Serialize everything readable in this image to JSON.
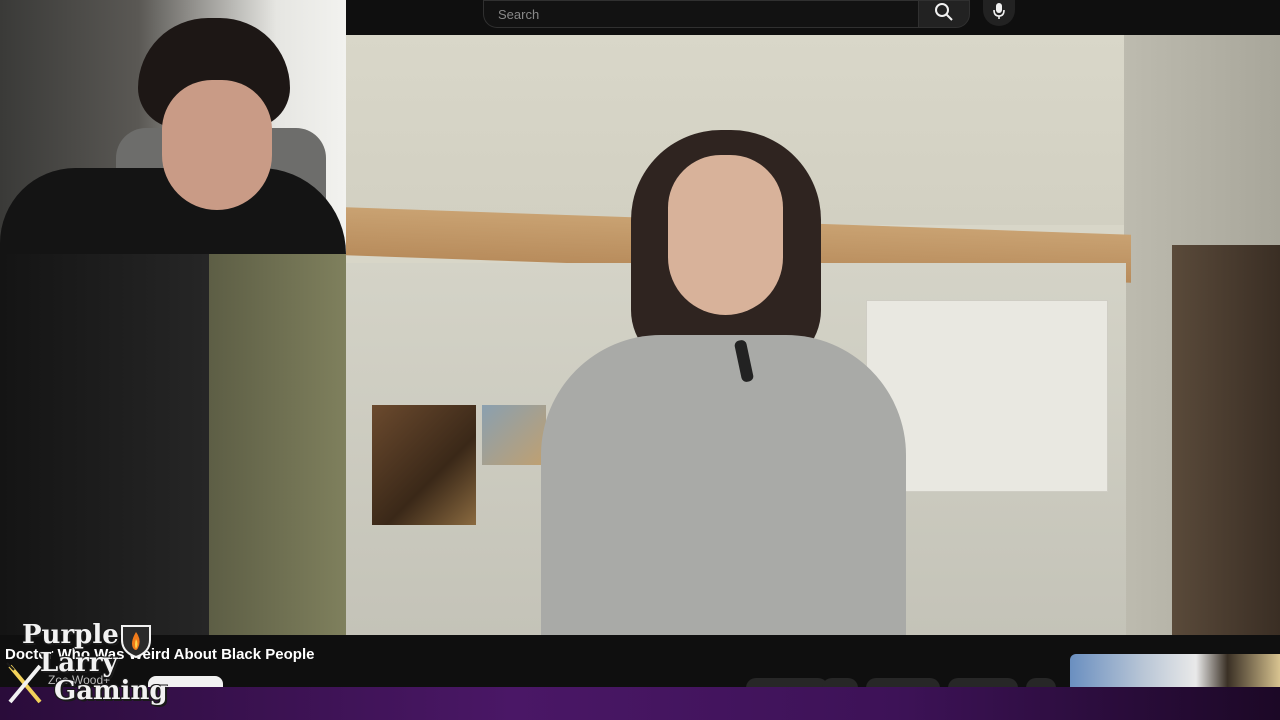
{
  "header": {
    "search_placeholder": "Search",
    "search_button_icon": "search-icon",
    "voice_search_icon": "microphone-icon"
  },
  "video": {
    "title": "Doctor Who Was Weird About Black People",
    "channel": "Zoe Wood+"
  },
  "logo": {
    "line1": "Purple",
    "line2": "Larry",
    "line3": "Gaming"
  },
  "colors": {
    "background": "#0f0f0f",
    "purple_strip": "#4a1766",
    "text": "#f1f1f1"
  }
}
